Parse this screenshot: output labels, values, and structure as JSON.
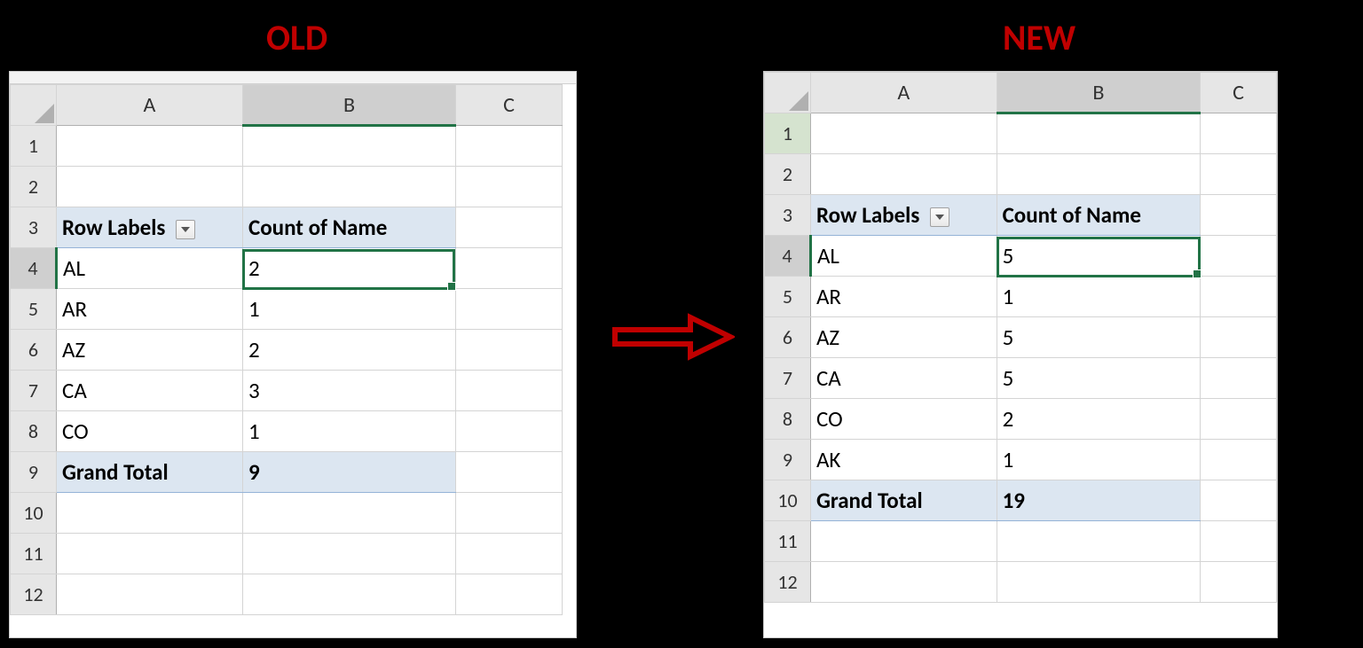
{
  "labels": {
    "old": "OLD",
    "new": "NEW"
  },
  "pivot": {
    "row_labels_header": "Row Labels",
    "value_header": "Count of Name",
    "grand_total_label": "Grand Total"
  },
  "columns": [
    "A",
    "B",
    "C"
  ],
  "old": {
    "row_numbers": [
      "1",
      "2",
      "3",
      "4",
      "5",
      "6",
      "7",
      "8",
      "9",
      "10",
      "11",
      "12"
    ],
    "rows": [
      {
        "label": "AL",
        "value": "2"
      },
      {
        "label": "AR",
        "value": "1"
      },
      {
        "label": "AZ",
        "value": "2"
      },
      {
        "label": "CA",
        "value": "3"
      },
      {
        "label": "CO",
        "value": "1"
      }
    ],
    "grand_total": "9",
    "selected_row_header": "4"
  },
  "new": {
    "row_numbers": [
      "1",
      "2",
      "3",
      "4",
      "5",
      "6",
      "7",
      "8",
      "9",
      "10",
      "11",
      "12"
    ],
    "rows": [
      {
        "label": "AL",
        "value": "5"
      },
      {
        "label": "AR",
        "value": "1"
      },
      {
        "label": "AZ",
        "value": "5"
      },
      {
        "label": "CA",
        "value": "5"
      },
      {
        "label": "CO",
        "value": "2"
      },
      {
        "label": "AK",
        "value": "1"
      }
    ],
    "grand_total": "19",
    "highlight_row_header": "1",
    "selected_row_header": "4"
  }
}
